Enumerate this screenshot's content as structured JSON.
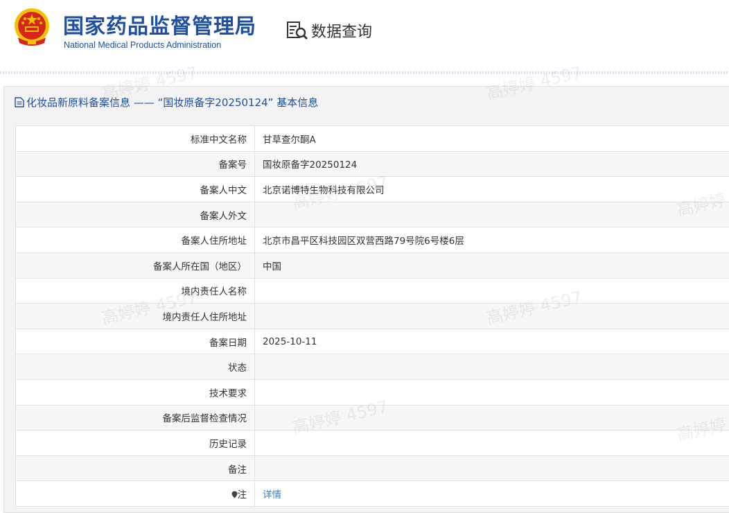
{
  "header": {
    "org_name_cn": "国家药品监督管理局",
    "org_name_en": "National Medical Products Administration",
    "data_query_label": "数据查询",
    "data_query_icon": "document-search-icon",
    "emblem_icon": "national-emblem-icon"
  },
  "section": {
    "title": "化妆品新原料备案信息 —— “国妆原备字20250124” 基本信息",
    "title_icon": "document-icon"
  },
  "fields": [
    {
      "key": "标准中文名称",
      "value": "甘草查尔酮A"
    },
    {
      "key": "备案号",
      "value": "国妆原备字20250124"
    },
    {
      "key": "备案人中文",
      "value": "北京诺博特生物科技有限公司"
    },
    {
      "key": "备案人外文",
      "value": ""
    },
    {
      "key": "备案人住所地址",
      "value": "北京市昌平区科技园区双营西路79号院6号楼6层"
    },
    {
      "key": "备案人所在国（地区）",
      "value": "中国"
    },
    {
      "key": "境内责任人名称",
      "value": ""
    },
    {
      "key": "境内责任人住所地址",
      "value": ""
    },
    {
      "key": "备案日期",
      "value": "2025-10-11"
    },
    {
      "key": "状态",
      "value": ""
    },
    {
      "key": "技术要求",
      "value": ""
    },
    {
      "key": "备案后监督检查情况",
      "value": ""
    },
    {
      "key": "历史记录",
      "value": ""
    },
    {
      "key": "备注",
      "value": ""
    },
    {
      "key": "注",
      "value": "详情",
      "key_icon": "location-pin-icon"
    }
  ],
  "watermark": "高婷婷 4597",
  "colors": {
    "brand_blue": "#1f4fa3",
    "link_blue": "#2f7fd6",
    "emblem_red": "#d7261b",
    "emblem_gold": "#f2c200"
  }
}
